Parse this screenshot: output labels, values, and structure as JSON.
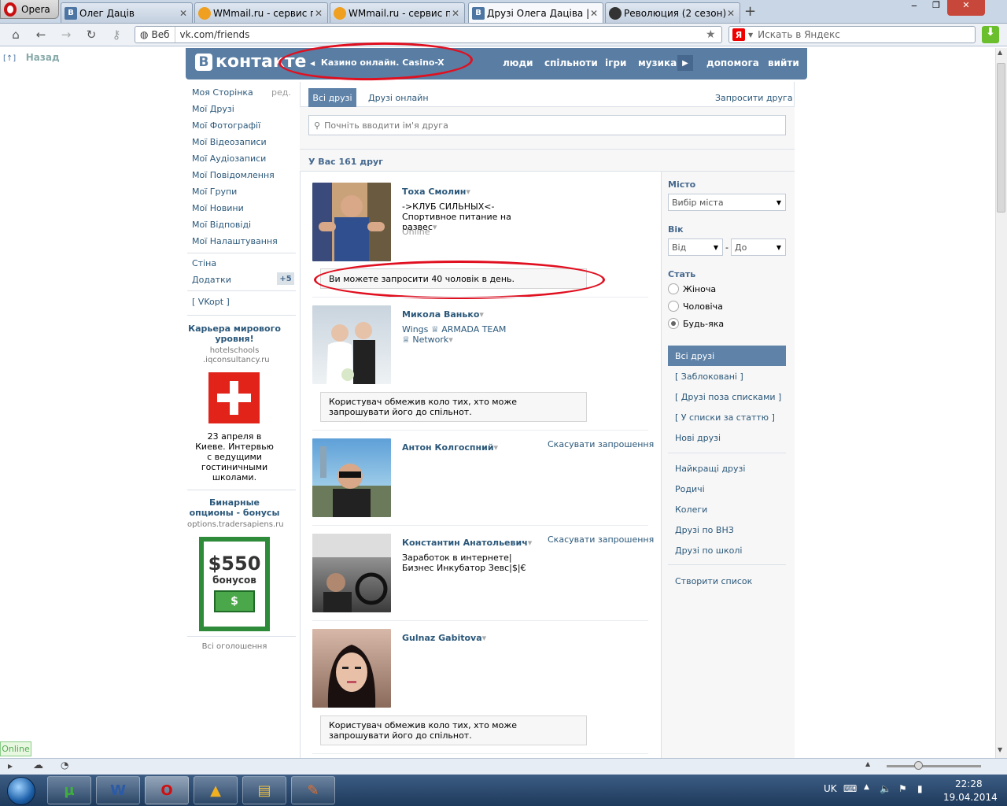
{
  "browser": {
    "opera_label": "Opera",
    "tabs": [
      {
        "label": "Олег Даців",
        "icon": "vk-icon"
      },
      {
        "label": "WMmail.ru - сервис п...",
        "icon": "wmmail-icon"
      },
      {
        "label": "WMmail.ru - сервис п...",
        "icon": "wmmail-icon"
      },
      {
        "label": "Друзі Олега Даціва | 1...",
        "icon": "vk-icon"
      },
      {
        "label": "Революция (2 сезон) с...",
        "icon": "revolution-icon"
      }
    ],
    "address_prefix": "Веб",
    "url": "vk.com/friends",
    "search_placeholder": "Искать в Яндекс"
  },
  "page": {
    "back_prefix": "[↑]",
    "back_label": "Назад"
  },
  "header": {
    "logo": "контакте",
    "ad_link": "Казино онлайн. Casino-X",
    "nav": [
      "люди",
      "спільноти",
      "ігри",
      "музика",
      "допомога",
      "вийти"
    ]
  },
  "sidebar": {
    "items": [
      "Моя Сторінка",
      "Мої Друзі",
      "Мої Фотографії",
      "Мої Відеозаписи",
      "Мої Аудіозаписи",
      "Мої Повідомлення",
      "Мої Групи",
      "Мої Новини",
      "Мої Відповіді",
      "Мої Налаштування"
    ],
    "edit": "ред.",
    "extra": [
      "Стіна",
      "Додатки"
    ],
    "apps_badge": "+5",
    "vkopt": "[ VKopt ]",
    "ad1": {
      "title": "Карьера мирового уровня!",
      "domain": "hotelschools .iqconsultancy.ru",
      "text": "23 апреля в Киеве. Интервью с ведущими гостиничными школами."
    },
    "ad2": {
      "title": "Бинарные опционы - бонусы",
      "domain": "options.tradersapiens.ru",
      "amount": "$550",
      "bonus_word": "бонусов",
      "money_sign": "$"
    },
    "all_ads": "Всі оголошення"
  },
  "main": {
    "tab_all": "Всі друзі",
    "tab_online": "Друзі онлайн",
    "invite": "Запросити друга",
    "search_placeholder": "Почніть вводити ім'я друга",
    "count": "У Вас 161 друг",
    "friends": [
      {
        "name": "Тоха Смолин",
        "sub": "->КЛУБ СИЛЬНЫХ<-Спортивное питание на развес",
        "status": "Online",
        "notice": "Ви можете запросити 40 чоловік в день."
      },
      {
        "name": "Микола Ванько",
        "sub": "Wings ♕ ARMADA TEAM ♕ Network",
        "notice": "Користувач обмежив коло тих, хто може запрошувати його до спільнот."
      },
      {
        "name": "Антон Колгоспний",
        "action": "Скасувати запрошення"
      },
      {
        "name": "Константин Анатольевич",
        "sub": "Заработок в интернете|Бизнес Инкубатор Зевс|$|€",
        "action": "Скасувати запрошення"
      },
      {
        "name": "Gulnaz Gabitova",
        "notice": "Користувач обмежив коло тих, хто може запрошувати його до спільнот."
      }
    ],
    "dropdown_marker": "▾"
  },
  "filters": {
    "city_label": "Місто",
    "city_value": "Вибір міста",
    "age_label": "Вік",
    "age_from": "Від",
    "age_dash": "-",
    "age_to": "До",
    "sex_label": "Стать",
    "sex_options": [
      "Жіноча",
      "Чоловіча",
      "Будь-яка"
    ],
    "sex_selected": "Будь-яка",
    "lists": [
      "Всі друзі",
      "[ Заблоковані ]",
      "[ Друзі поза списками ]",
      "[ У списки за статтю ]",
      "Нові друзі"
    ],
    "groups": [
      "Найкращі друзі",
      "Родичі",
      "Колеги",
      "Друзі по ВНЗ",
      "Друзі по школі"
    ],
    "create": "Створити список"
  },
  "status": {
    "online": "Online"
  },
  "taskbar": {
    "lang": "UK",
    "time": "22:28",
    "date": "19.04.2014"
  },
  "colors": {
    "vk_blue": "#597da3",
    "link": "#2b587a",
    "annotation_red": "#e01020"
  }
}
